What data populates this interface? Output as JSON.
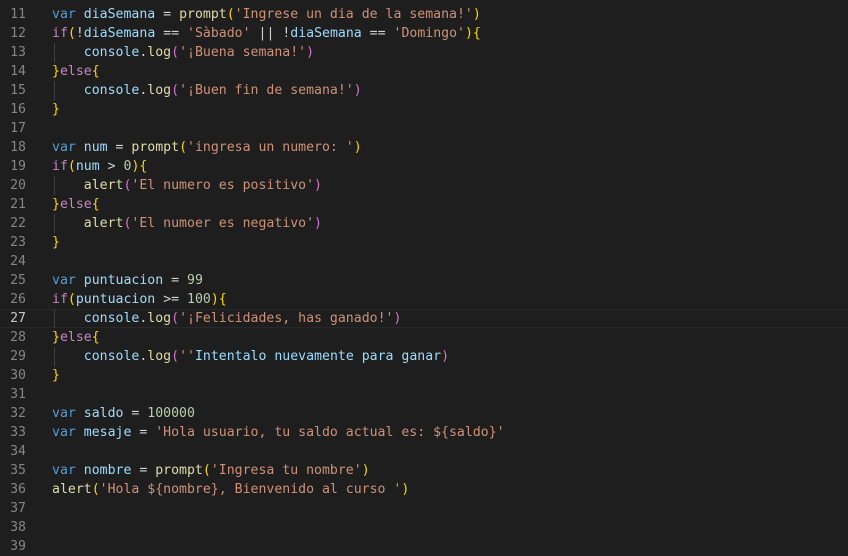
{
  "editor": {
    "current_line": "27",
    "lines": [
      {
        "n": "11",
        "tokens": [
          [
            "kw",
            "var "
          ],
          [
            "var",
            "diaSemana"
          ],
          [
            "op",
            " = "
          ],
          [
            "fn",
            "prompt"
          ],
          [
            "b1",
            "("
          ],
          [
            "str",
            "'Ingrese un dia de la semana!'"
          ],
          [
            "b1",
            ")"
          ]
        ]
      },
      {
        "n": "12",
        "tokens": [
          [
            "ctl",
            "if"
          ],
          [
            "b1",
            "("
          ],
          [
            "op",
            "!"
          ],
          [
            "var",
            "diaSemana"
          ],
          [
            "op",
            " == "
          ],
          [
            "str",
            "'Sàbado'"
          ],
          [
            "op",
            " || !"
          ],
          [
            "var",
            "diaSemana"
          ],
          [
            "op",
            " == "
          ],
          [
            "str",
            "'Domingo'"
          ],
          [
            "b1",
            ")"
          ],
          [
            "b1",
            "{"
          ]
        ]
      },
      {
        "n": "13",
        "tokens": [
          [
            "op",
            "    "
          ],
          [
            "var",
            "console"
          ],
          [
            "op",
            "."
          ],
          [
            "fn",
            "log"
          ],
          [
            "b2",
            "("
          ],
          [
            "str",
            "'¡Buena semana!'"
          ],
          [
            "b2",
            ")"
          ]
        ]
      },
      {
        "n": "14",
        "tokens": [
          [
            "b1",
            "}"
          ],
          [
            "ctl",
            "else"
          ],
          [
            "b1",
            "{"
          ]
        ]
      },
      {
        "n": "15",
        "tokens": [
          [
            "op",
            "    "
          ],
          [
            "var",
            "console"
          ],
          [
            "op",
            "."
          ],
          [
            "fn",
            "log"
          ],
          [
            "b2",
            "("
          ],
          [
            "str",
            "'¡Buen fin de semana!'"
          ],
          [
            "b2",
            ")"
          ]
        ]
      },
      {
        "n": "16",
        "tokens": [
          [
            "b1",
            "}"
          ]
        ]
      },
      {
        "n": "17",
        "tokens": []
      },
      {
        "n": "18",
        "tokens": [
          [
            "kw",
            "var "
          ],
          [
            "var",
            "num"
          ],
          [
            "op",
            " = "
          ],
          [
            "fn",
            "prompt"
          ],
          [
            "b1",
            "("
          ],
          [
            "str",
            "'ingresa un numero: '"
          ],
          [
            "b1",
            ")"
          ]
        ]
      },
      {
        "n": "19",
        "tokens": [
          [
            "ctl",
            "if"
          ],
          [
            "b1",
            "("
          ],
          [
            "var",
            "num"
          ],
          [
            "op",
            " > "
          ],
          [
            "num",
            "0"
          ],
          [
            "b1",
            ")"
          ],
          [
            "b1",
            "{"
          ]
        ]
      },
      {
        "n": "20",
        "tokens": [
          [
            "op",
            "    "
          ],
          [
            "fn",
            "alert"
          ],
          [
            "b2",
            "("
          ],
          [
            "str",
            "'El numero es positivo'"
          ],
          [
            "b2",
            ")"
          ]
        ]
      },
      {
        "n": "21",
        "tokens": [
          [
            "b1",
            "}"
          ],
          [
            "ctl",
            "else"
          ],
          [
            "b1",
            "{"
          ]
        ]
      },
      {
        "n": "22",
        "tokens": [
          [
            "op",
            "    "
          ],
          [
            "fn",
            "alert"
          ],
          [
            "b2",
            "("
          ],
          [
            "str",
            "'El numoer es negativo'"
          ],
          [
            "b2",
            ")"
          ]
        ]
      },
      {
        "n": "23",
        "tokens": [
          [
            "b1",
            "}"
          ]
        ]
      },
      {
        "n": "24",
        "tokens": []
      },
      {
        "n": "25",
        "tokens": [
          [
            "kw",
            "var "
          ],
          [
            "var",
            "puntuacion"
          ],
          [
            "op",
            " = "
          ],
          [
            "num",
            "99"
          ]
        ]
      },
      {
        "n": "26",
        "tokens": [
          [
            "ctl",
            "if"
          ],
          [
            "b1",
            "("
          ],
          [
            "var",
            "puntuacion"
          ],
          [
            "op",
            " >= "
          ],
          [
            "num",
            "100"
          ],
          [
            "b1",
            ")"
          ],
          [
            "b1",
            "{"
          ]
        ]
      },
      {
        "n": "27",
        "tokens": [
          [
            "op",
            "    "
          ],
          [
            "var",
            "console"
          ],
          [
            "op",
            "."
          ],
          [
            "fn",
            "log"
          ],
          [
            "b2",
            "("
          ],
          [
            "str",
            "'¡Felicidades, has ganado!'"
          ],
          [
            "b2",
            ")"
          ]
        ]
      },
      {
        "n": "28",
        "tokens": [
          [
            "b1",
            "}"
          ],
          [
            "ctl",
            "else"
          ],
          [
            "b1",
            "{"
          ]
        ]
      },
      {
        "n": "29",
        "tokens": [
          [
            "op",
            "    "
          ],
          [
            "var",
            "console"
          ],
          [
            "op",
            "."
          ],
          [
            "fn",
            "log"
          ],
          [
            "b2",
            "("
          ],
          [
            "str",
            "''"
          ],
          [
            "var",
            "Intentalo nuevamente para ganar"
          ],
          [
            "b2",
            ")"
          ]
        ]
      },
      {
        "n": "30",
        "tokens": [
          [
            "b1",
            "}"
          ]
        ]
      },
      {
        "n": "31",
        "tokens": []
      },
      {
        "n": "32",
        "tokens": [
          [
            "kw",
            "var "
          ],
          [
            "var",
            "saldo"
          ],
          [
            "op",
            " = "
          ],
          [
            "num",
            "100000"
          ]
        ]
      },
      {
        "n": "33",
        "tokens": [
          [
            "kw",
            "var "
          ],
          [
            "var",
            "mesaje"
          ],
          [
            "op",
            " = "
          ],
          [
            "str",
            "'Hola usuario, tu saldo actual es: ${saldo}'"
          ]
        ]
      },
      {
        "n": "34",
        "tokens": []
      },
      {
        "n": "35",
        "tokens": [
          [
            "kw",
            "var "
          ],
          [
            "var",
            "nombre"
          ],
          [
            "op",
            " = "
          ],
          [
            "fn",
            "prompt"
          ],
          [
            "b1",
            "("
          ],
          [
            "str",
            "'Ingresa tu nombre'"
          ],
          [
            "b1",
            ")"
          ]
        ]
      },
      {
        "n": "36",
        "tokens": [
          [
            "fn",
            "alert"
          ],
          [
            "b1",
            "("
          ],
          [
            "str",
            "'Hola ${nombre}, Bienvenido al curso '"
          ],
          [
            "b1",
            ")"
          ]
        ]
      },
      {
        "n": "37",
        "tokens": []
      },
      {
        "n": "38",
        "tokens": []
      },
      {
        "n": "39",
        "tokens": []
      }
    ]
  },
  "colors": {
    "background": "#1e1e1e",
    "keyword": "#569cd6",
    "control": "#c586c0",
    "variable": "#9cdcfe",
    "function": "#dcdcaa",
    "string": "#ce9178",
    "number": "#b5cea8",
    "bracket_level1": "#ffd700",
    "bracket_level2": "#da70d6"
  }
}
